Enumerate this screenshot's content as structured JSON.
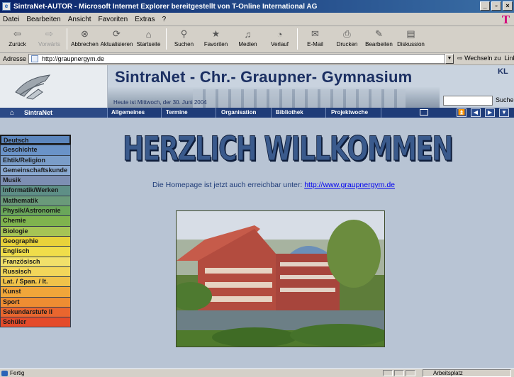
{
  "window": {
    "title": "SintraNet-AUTOR - Microsoft Internet Explorer bereitgestellt von T-Online International AG",
    "controls": [
      "_",
      "▫",
      "×"
    ]
  },
  "menu": [
    "Datei",
    "Bearbeiten",
    "Ansicht",
    "Favoriten",
    "Extras",
    "?"
  ],
  "brand_glyph": "T",
  "toolbar": [
    {
      "label": "Zurück",
      "icon": "back-arrow-icon",
      "glyph": "⇦"
    },
    {
      "label": "Vorwärts",
      "icon": "forward-arrow-icon",
      "glyph": "⇨",
      "disabled": true
    },
    {
      "label": "Abbrechen",
      "icon": "stop-icon",
      "glyph": "⊗"
    },
    {
      "label": "Aktualisieren",
      "icon": "refresh-icon",
      "glyph": "⟳"
    },
    {
      "label": "Startseite",
      "icon": "home-icon",
      "glyph": "⌂"
    },
    {
      "label": "Suchen",
      "icon": "search-icon",
      "glyph": "⚲"
    },
    {
      "label": "Favoriten",
      "icon": "favorites-icon",
      "glyph": "★"
    },
    {
      "label": "Medien",
      "icon": "media-icon",
      "glyph": "♫"
    },
    {
      "label": "Verlauf",
      "icon": "history-icon",
      "glyph": "◔"
    },
    {
      "label": "E-Mail",
      "icon": "mail-icon",
      "glyph": "✉"
    },
    {
      "label": "Drucken",
      "icon": "print-icon",
      "glyph": "⎙"
    },
    {
      "label": "Bearbeiten",
      "icon": "edit-icon",
      "glyph": "✎"
    },
    {
      "label": "Diskussion",
      "icon": "discuss-icon",
      "glyph": "▤"
    }
  ],
  "address": {
    "label": "Adresse",
    "url": "http://graupnergym.de",
    "go_label": "Wechseln zu",
    "links_label": "Links"
  },
  "header": {
    "site_title": "SintraNet - Chr.- Graupner- Gymnasium",
    "date_line": "Heute ist Mittwoch, der 30. Juni 2004",
    "search_button": "Suche",
    "corner_logo": "KL"
  },
  "nav": {
    "home_label": "SintraNet",
    "tabs": [
      "Allgemeines",
      "Termine",
      "Organisation",
      "Bibliothek",
      "Projektwoche"
    ],
    "arrows": [
      "⏫",
      "◀",
      "▶",
      "▼"
    ]
  },
  "sidebar": [
    {
      "label": "Deutsch",
      "color": "#5c86bd"
    },
    {
      "label": "Geschichte",
      "color": "#6a93c8"
    },
    {
      "label": "Ehtik/Religion",
      "color": "#7a9dc9"
    },
    {
      "label": "Gemeinschaftskunde",
      "color": "#8aa9d1"
    },
    {
      "label": "Musik",
      "color": "#7d8fb3"
    },
    {
      "label": "Informatik/Werken",
      "color": "#5e8f86"
    },
    {
      "label": "Mathematik",
      "color": "#6a9a7a"
    },
    {
      "label": "Physik/Astronomie",
      "color": "#6aa65a"
    },
    {
      "label": "Chemie",
      "color": "#7fb34e"
    },
    {
      "label": "Biologie",
      "color": "#a6c455"
    },
    {
      "label": "Geographie",
      "color": "#e8d23a"
    },
    {
      "label": "Englisch",
      "color": "#f0dd4a"
    },
    {
      "label": "Französisch",
      "color": "#f1e06a"
    },
    {
      "label": "Russisch",
      "color": "#f2d65a"
    },
    {
      "label": "Lat. / Span. / It.",
      "color": "#f0c24a"
    },
    {
      "label": "Kunst",
      "color": "#f0a63a"
    },
    {
      "label": "Sport",
      "color": "#ee8d32"
    },
    {
      "label": "Sekundarstufe II",
      "color": "#e9662e"
    },
    {
      "label": "Schüler",
      "color": "#e44b2a"
    }
  ],
  "main": {
    "welcome": "HERZLICH WILLKOMMEN",
    "homepage_text": "Die Homepage ist jetzt auch erreichbar unter: ",
    "homepage_link": "http://www.graupnergym.de"
  },
  "status": {
    "text": "Fertig",
    "zone": "Arbeitsplatz"
  }
}
